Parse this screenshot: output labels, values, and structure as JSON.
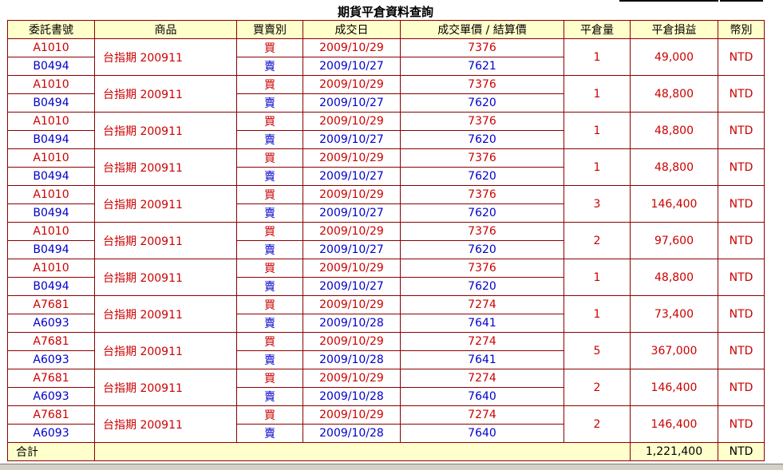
{
  "title": "期貨平倉資料查詢",
  "headers": [
    "委託書號",
    "商品",
    "買賣別",
    "成交日",
    "成交單價 / 結算價",
    "平倉量",
    "平倉損益",
    "幣別"
  ],
  "rows": [
    {
      "buy_no": "A1010",
      "sell_no": "B0494",
      "product": "台指期 200911",
      "buy_label": "買",
      "sell_label": "賣",
      "buy_date": "2009/10/29",
      "sell_date": "2009/10/27",
      "buy_price": "7376",
      "sell_price": "7621",
      "qty": "1",
      "pnl": "49,000",
      "currency": "NTD"
    },
    {
      "buy_no": "A1010",
      "sell_no": "B0494",
      "product": "台指期 200911",
      "buy_label": "買",
      "sell_label": "賣",
      "buy_date": "2009/10/29",
      "sell_date": "2009/10/27",
      "buy_price": "7376",
      "sell_price": "7620",
      "qty": "1",
      "pnl": "48,800",
      "currency": "NTD"
    },
    {
      "buy_no": "A1010",
      "sell_no": "B0494",
      "product": "台指期 200911",
      "buy_label": "買",
      "sell_label": "賣",
      "buy_date": "2009/10/29",
      "sell_date": "2009/10/27",
      "buy_price": "7376",
      "sell_price": "7620",
      "qty": "1",
      "pnl": "48,800",
      "currency": "NTD"
    },
    {
      "buy_no": "A1010",
      "sell_no": "B0494",
      "product": "台指期 200911",
      "buy_label": "買",
      "sell_label": "賣",
      "buy_date": "2009/10/29",
      "sell_date": "2009/10/27",
      "buy_price": "7376",
      "sell_price": "7620",
      "qty": "1",
      "pnl": "48,800",
      "currency": "NTD"
    },
    {
      "buy_no": "A1010",
      "sell_no": "B0494",
      "product": "台指期 200911",
      "buy_label": "買",
      "sell_label": "賣",
      "buy_date": "2009/10/29",
      "sell_date": "2009/10/27",
      "buy_price": "7376",
      "sell_price": "7620",
      "qty": "3",
      "pnl": "146,400",
      "currency": "NTD"
    },
    {
      "buy_no": "A1010",
      "sell_no": "B0494",
      "product": "台指期 200911",
      "buy_label": "買",
      "sell_label": "賣",
      "buy_date": "2009/10/29",
      "sell_date": "2009/10/27",
      "buy_price": "7376",
      "sell_price": "7620",
      "qty": "2",
      "pnl": "97,600",
      "currency": "NTD"
    },
    {
      "buy_no": "A1010",
      "sell_no": "B0494",
      "product": "台指期 200911",
      "buy_label": "買",
      "sell_label": "賣",
      "buy_date": "2009/10/29",
      "sell_date": "2009/10/27",
      "buy_price": "7376",
      "sell_price": "7620",
      "qty": "1",
      "pnl": "48,800",
      "currency": "NTD"
    },
    {
      "buy_no": "A7681",
      "sell_no": "A6093",
      "product": "台指期 200911",
      "buy_label": "買",
      "sell_label": "賣",
      "buy_date": "2009/10/29",
      "sell_date": "2009/10/28",
      "buy_price": "7274",
      "sell_price": "7641",
      "qty": "1",
      "pnl": "73,400",
      "currency": "NTD"
    },
    {
      "buy_no": "A7681",
      "sell_no": "A6093",
      "product": "台指期 200911",
      "buy_label": "買",
      "sell_label": "賣",
      "buy_date": "2009/10/29",
      "sell_date": "2009/10/28",
      "buy_price": "7274",
      "sell_price": "7641",
      "qty": "5",
      "pnl": "367,000",
      "currency": "NTD"
    },
    {
      "buy_no": "A7681",
      "sell_no": "A6093",
      "product": "台指期 200911",
      "buy_label": "買",
      "sell_label": "賣",
      "buy_date": "2009/10/29",
      "sell_date": "2009/10/28",
      "buy_price": "7274",
      "sell_price": "7640",
      "qty": "2",
      "pnl": "146,400",
      "currency": "NTD"
    },
    {
      "buy_no": "A7681",
      "sell_no": "A6093",
      "product": "台指期 200911",
      "buy_label": "買",
      "sell_label": "賣",
      "buy_date": "2009/10/29",
      "sell_date": "2009/10/28",
      "buy_price": "7274",
      "sell_price": "7640",
      "qty": "2",
      "pnl": "146,400",
      "currency": "NTD"
    }
  ],
  "footer": {
    "label": "合計",
    "total": "1,221,400",
    "currency": "NTD"
  },
  "colors": {
    "header_bg": "#ffffcc",
    "border": "#8b0000",
    "buy": "#cc0000",
    "sell": "#0000cc"
  }
}
